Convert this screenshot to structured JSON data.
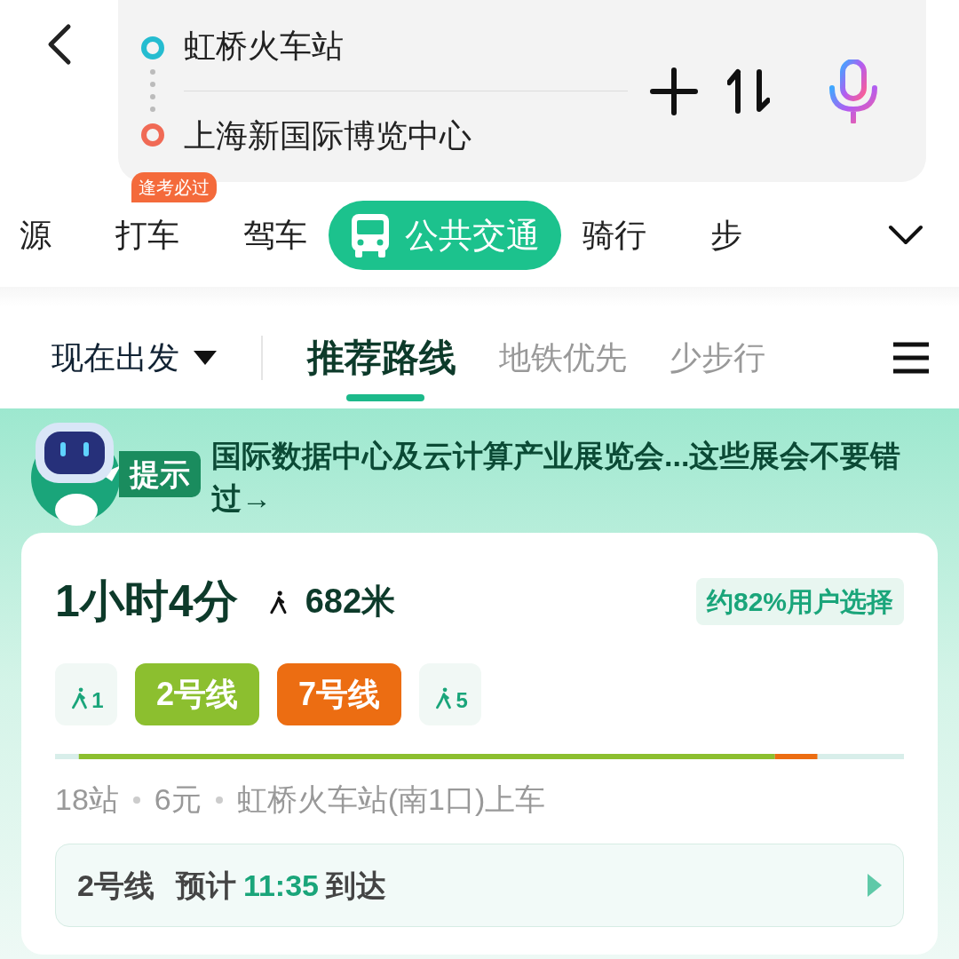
{
  "search": {
    "origin": "虹桥火车站",
    "destination": "上海新国际博览中心"
  },
  "modes": [
    {
      "label": "源",
      "selected": false
    },
    {
      "label": "打车",
      "selected": false,
      "badge": "逢考必过"
    },
    {
      "label": "驾车",
      "selected": false
    },
    {
      "label": "公共交通",
      "selected": true
    },
    {
      "label": "骑行",
      "selected": false
    },
    {
      "label": "步",
      "selected": false
    }
  ],
  "depart": "现在出发",
  "sort_tabs": [
    {
      "label": "推荐路线",
      "selected": true
    },
    {
      "label": "地铁优先",
      "selected": false
    },
    {
      "label": "少步行",
      "selected": false
    }
  ],
  "tip": {
    "badge": "提示",
    "text": "国际数据中心及云计算产业展览会...这些展会不要错过→"
  },
  "route": {
    "duration": "1小时4分",
    "walk": "682米",
    "popularity": "约82%用户选择",
    "legs": [
      {
        "kind": "walk",
        "text": "1"
      },
      {
        "kind": "line",
        "text": "2号线",
        "color": "#8cbf2f"
      },
      {
        "kind": "line",
        "text": "7号线",
        "color": "#ec6d12"
      },
      {
        "kind": "walk",
        "text": "5"
      }
    ],
    "stats": [
      "18站",
      "6元",
      "虹桥火车站(南1口)上车"
    ],
    "arrival": {
      "line": "2号线",
      "prefix": "预计",
      "time": "11:35",
      "suffix": "到达"
    }
  }
}
